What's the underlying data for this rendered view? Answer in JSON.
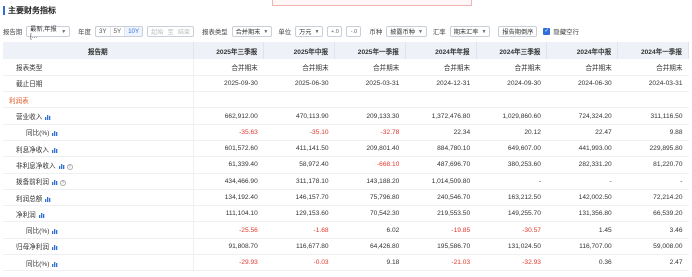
{
  "section": {
    "title": "主要财务指标"
  },
  "toolbar": {
    "report_period_label": "报告期",
    "report_period_value": "最新,年报[...",
    "year_label": "年度",
    "year_options": [
      "3Y",
      "5Y",
      "10Y"
    ],
    "year_active": "10Y",
    "range_start": "起始",
    "range_to": "至",
    "range_end": "结束",
    "report_type_label": "报表类型",
    "report_type_value": "合并期末",
    "unit_label": "单位",
    "unit_value": "万元",
    "decimal_inc": "+.0",
    "decimal_dec": "-.0",
    "currency_label": "币种",
    "currency_value": "披露币种",
    "fx_label": "汇率",
    "fx_value": "期末汇率",
    "order_label": "报告期倒序",
    "hide_empty_label": "隐藏空行",
    "hide_empty_checked": true
  },
  "table": {
    "header_first": "报告期",
    "columns": [
      "2025年三季报",
      "2025年中报",
      "2025年一季报",
      "2024年年报",
      "2024年三季报",
      "2024年中报",
      "2024年一季报"
    ],
    "rows": [
      {
        "name": "报表类型",
        "values": [
          "合并期末",
          "合并期末",
          "合并期末",
          "合并期末",
          "合并期末",
          "合并期末",
          "合并期末"
        ]
      },
      {
        "name": "截止日期",
        "values": [
          "2025-09-30",
          "2025-06-30",
          "2025-03-31",
          "2024-12-31",
          "2024-09-30",
          "2024-06-30",
          "2024-03-31"
        ]
      },
      {
        "name": "利润表",
        "group": true,
        "values": [
          "",
          "",
          "",
          "",
          "",
          "",
          ""
        ]
      },
      {
        "name": "营业收入",
        "chart": true,
        "values": [
          "662,912.00",
          "470,113.90",
          "209,133.30",
          "1,372,476.80",
          "1,029,860.60",
          "724,324.20",
          "311,116.50"
        ]
      },
      {
        "name": "同比(%)",
        "sub": true,
        "chart": true,
        "values": [
          "-35.63",
          "-35.10",
          "-32.78",
          "22.34",
          "20.12",
          "22.47",
          "9.88"
        ]
      },
      {
        "name": "利息净收入",
        "chart": true,
        "values": [
          "601,572.60",
          "411,141.50",
          "209,801.40",
          "884,780.10",
          "649,607.00",
          "441,993.00",
          "229,895.80"
        ]
      },
      {
        "name": "非利息净收入",
        "chart": true,
        "help": true,
        "values": [
          "61,339.40",
          "58,972.40",
          "-668.10",
          "487,696.70",
          "380,253.60",
          "282,331.20",
          "81,220.70"
        ]
      },
      {
        "name": "拨备前利润",
        "chart": true,
        "help": true,
        "values": [
          "434,466.90",
          "311,178.10",
          "143,188.20",
          "1,014,509.80",
          "-",
          "-",
          "-"
        ]
      },
      {
        "name": "利润总额",
        "chart": true,
        "values": [
          "134,192.40",
          "146,157.70",
          "75,796.80",
          "240,546.70",
          "163,212.50",
          "142,002.50",
          "72,214.20"
        ]
      },
      {
        "name": "净利润",
        "chart": true,
        "values": [
          "111,104.10",
          "129,153.60",
          "70,542.30",
          "219,553.50",
          "149,255.70",
          "131,356.80",
          "66,539.20"
        ]
      },
      {
        "name": "同比(%)",
        "sub": true,
        "chart": true,
        "values": [
          "-25.56",
          "-1.68",
          "6.02",
          "-19.85",
          "-30.57",
          "1.45",
          "3.46"
        ]
      },
      {
        "name": "归母净利润",
        "chart": true,
        "values": [
          "91,808.70",
          "116,677.80",
          "64,426.80",
          "195,586.70",
          "131,024.50",
          "116,707.00",
          "59,008.00"
        ]
      },
      {
        "name": "同比(%)",
        "sub": true,
        "chart": true,
        "values": [
          "-29.93",
          "-0.03",
          "9.18",
          "-21.03",
          "-32.93",
          "0.36",
          "2.47"
        ]
      }
    ]
  },
  "colors": {
    "accent": "#2f6fd6",
    "negative": "#e0382d",
    "group": "#e05a2b",
    "header_bg": "#eef2f8"
  },
  "icons": {
    "row_chart": "bar-chart-icon",
    "help": "help-circle-icon",
    "dropdown": "chevron-down-icon",
    "checkbox": "checkbox-checked-icon"
  }
}
